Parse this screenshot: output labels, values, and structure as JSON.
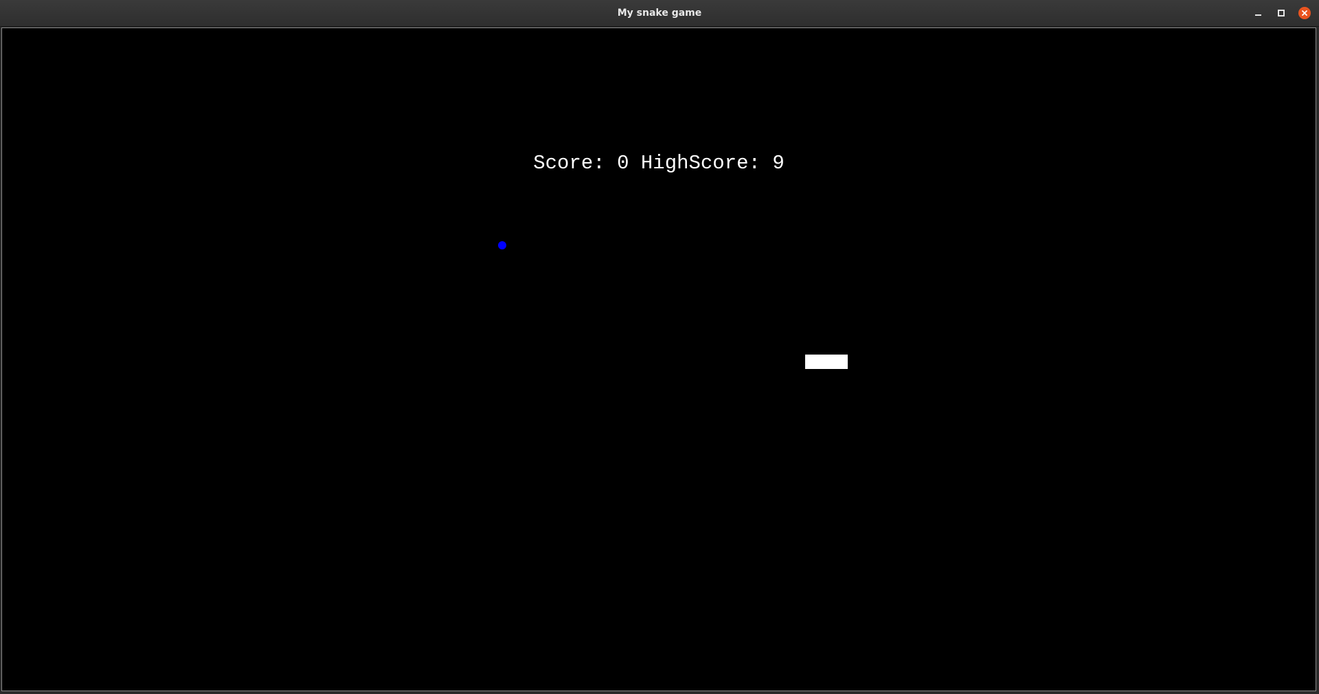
{
  "window": {
    "title": "My snake game",
    "controls": {
      "minimize_icon": "minimize-icon",
      "maximize_icon": "maximize-icon",
      "close_icon": "close-icon",
      "close_color": "#e95420"
    }
  },
  "game": {
    "background_color": "#000000",
    "score_label": "Score:",
    "score_value": "0",
    "highscore_label": "HighScore:",
    "highscore_value": "9",
    "food_color": "#0000ff",
    "snake_color": "#ffffff"
  }
}
